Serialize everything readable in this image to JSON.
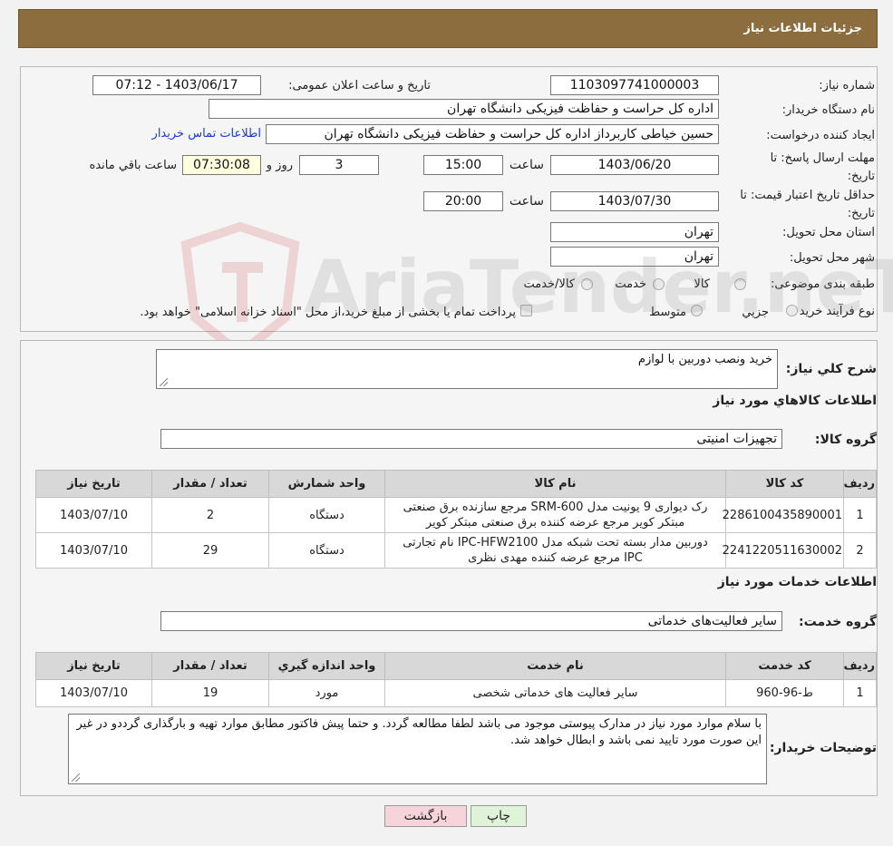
{
  "header": {
    "title": "جزئیات اطلاعات نیاز"
  },
  "info": {
    "need_number_label": "شماره نیاز:",
    "need_number": "1103097741000003",
    "announce_label": "تاریخ و ساعت اعلان عمومی:",
    "announce_value": "1403/06/17 - 07:12",
    "buyer_label": "نام دستگاه خریدار:",
    "buyer_value": "اداره کل حراست و حفاظت فیزیکی دانشگاه تهران",
    "creator_label": "ایجاد کننده درخواست:",
    "creator_value": "حسین خیاطی کاربرداز اداره کل حراست و حفاظت فیزیکی دانشگاه تهران",
    "contact_link": "اطلاعات تماس خریدار",
    "deadline_label_1": "مهلت ارسال پاسخ: تا",
    "deadline_label_2": "تاریخ:",
    "deadline_date": "1403/06/20",
    "time_label": "ساعت",
    "deadline_time": "15:00",
    "days_value": "3",
    "days_label": "روز و",
    "remaining_time": "07:30:08",
    "remaining_label": "ساعت باقي مانده",
    "validity_label_1": "حداقل تاریخ اعتبار قیمت: تا",
    "validity_label_2": "تاریخ:",
    "validity_date": "1403/07/30",
    "validity_time_label": "ساعت",
    "validity_time": "20:00",
    "province_label": "استان محل تحویل:",
    "province_value": "تهران",
    "city_label": "شهر محل تحویل:",
    "city_value": "تهران",
    "category_label": "طبقه بندی موضوعی:",
    "category_options": [
      "کالا",
      "خدمت",
      "کالا/خدمت"
    ],
    "purchase_type_label": "نوع فرآیند خرید :",
    "purchase_options": [
      "جزيي",
      "متوسط"
    ],
    "purchase_note": "پرداخت تمام یا بخشی از مبلغ خرید،از محل \"اسناد خزانه اسلامی\" خواهد بود."
  },
  "description": {
    "label": "شرح كلي نياز:",
    "value": "خرید ونصب دوربین با لوازم"
  },
  "goods": {
    "section_title": "اطلاعات كالاهاي مورد نياز",
    "group_label": "گروه كالا:",
    "group_value": "تجهیزات امنیتی",
    "columns": [
      "رديف",
      "كد كالا",
      "نام كالا",
      "واحد شمارش",
      "تعداد / مقدار",
      "تاريخ نياز"
    ],
    "rows": [
      {
        "index": "1",
        "code": "2286100435890001",
        "name": "رک دیواری 9 یونیت مدل SRM-600 مرجع سازنده برق صنعتی مبتکر کویر مرجع عرضه کننده برق صنعتی مبتکر کویر",
        "unit": "دستگاه",
        "qty": "2",
        "date": "1403/07/10"
      },
      {
        "index": "2",
        "code": "2241220511630002",
        "name": "دوربین مدار بسته تحت شبکه مدل IPC-HFW2100 نام تجارتی IPC مرجع عرضه کننده مهدی نظری",
        "unit": "دستگاه",
        "qty": "29",
        "date": "1403/07/10"
      }
    ]
  },
  "services": {
    "section_title": "اطلاعات خدمات مورد نياز",
    "group_label": "گروه خدمت:",
    "group_value": "سایر فعالیت‌های خدماتی",
    "columns": [
      "رديف",
      "كد خدمت",
      "نام خدمت",
      "واحد اندازه گيري",
      "تعداد / مقدار",
      "تاريخ نياز"
    ],
    "rows": [
      {
        "index": "1",
        "code": "ط-96-960",
        "name": "سایر فعالیت های خدماتی شخصی",
        "unit": "مورد",
        "qty": "19",
        "date": "1403/07/10"
      }
    ]
  },
  "buyer_notes": {
    "label": "توضیحات خریدار:",
    "value": "با سلام موارد مورد نیاز در مدارک پیوستی موجود می باشد لطفا مطالعه گردد. و حتما پیش فاکتور مطابق موارد تهیه و بارگذاری گرددو در غیر این صورت مورد تایید نمی باشد و ابطال خواهد شد."
  },
  "buttons": {
    "print": "چاپ",
    "back": "بازگشت"
  },
  "watermark": {
    "text": "AriaTender.neT"
  },
  "colors": {
    "header": "#8b6d3e",
    "link": "#1a3cc8",
    "back_button": "#f7d4dc",
    "print_button": "#dff3d9"
  }
}
